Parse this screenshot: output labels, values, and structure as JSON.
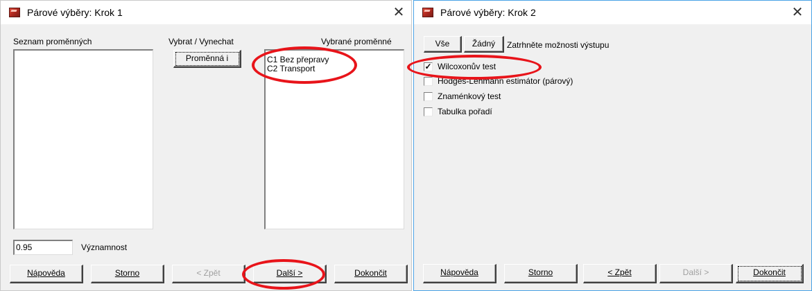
{
  "step1": {
    "title": "Párové výběry: Krok 1",
    "close_glyph": "✕",
    "variables_list_label": "Seznam proměnných",
    "select_label": "Vybrat / Vynechat",
    "variable_button": "Proměnná i",
    "selected_label": "Vybrané proměnné",
    "selected_items": [
      "C1 Bez přepravy",
      "C2 Transport"
    ],
    "significance_value": "0.95",
    "significance_label": "Významnost",
    "buttons": {
      "help": "Nápověda",
      "cancel": "Storno",
      "back": "< Zpět",
      "next": "Další >",
      "finish": "Dokončit"
    }
  },
  "step2": {
    "title": "Párové výběry: Krok 2",
    "close_glyph": "✕",
    "all_button": "Vše",
    "none_button": "Žádný",
    "instruction": "Zatrhněte možnosti výstupu",
    "options": [
      {
        "label": "Wilcoxonův test",
        "checked": true
      },
      {
        "label": "Hodges-Lehmann estimátor (párový)",
        "checked": false
      },
      {
        "label": "Znaménkový test",
        "checked": false
      },
      {
        "label": "Tabulka  pořadí",
        "checked": false
      }
    ],
    "buttons": {
      "help": "Nápověda",
      "cancel": "Storno",
      "back": "< Zpět",
      "next": "Další >",
      "finish": "Dokončit"
    }
  },
  "colors": {
    "highlight": "#e8141a",
    "dialog_bg": "#f0f0f0",
    "active_border": "#4aa3e6"
  }
}
